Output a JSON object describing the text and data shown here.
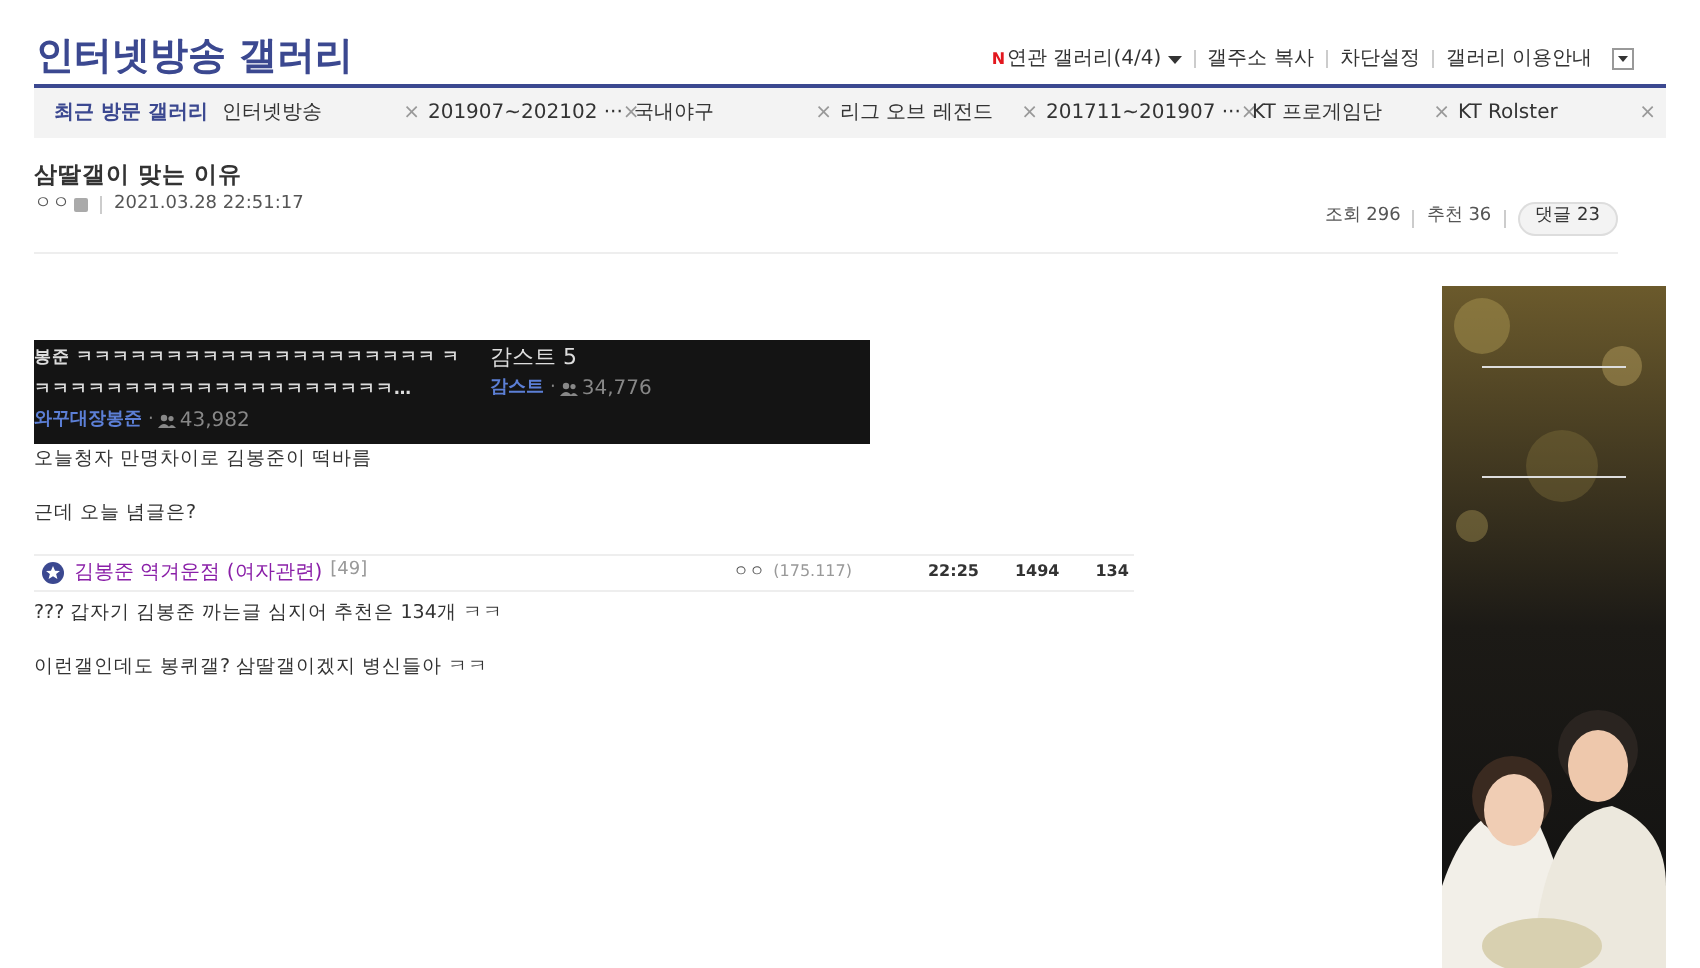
{
  "gallery": {
    "title": "인터넷방송 갤러리"
  },
  "top_links": [
    {
      "kind": "dropdown",
      "new_mark": "N",
      "label": "연관 갤러리(4/4)"
    },
    {
      "kind": "link",
      "label": "갤주소 복사"
    },
    {
      "kind": "link",
      "label": "차단설정"
    },
    {
      "kind": "link",
      "label": "갤러리 이용안내"
    },
    {
      "kind": "menu"
    }
  ],
  "recent_bar": {
    "label": "최근 방문 갤러리",
    "remove_mark": "×",
    "items": [
      "인터넷방송",
      "201907~202102 ···",
      "국내야구",
      "리그 오브 레전드",
      "201711~201907 ···",
      "KT 프로게임단",
      "KT Rolster"
    ]
  },
  "post": {
    "title": "삼딸갤이 맞는 이유",
    "author": "ㅇㅇ",
    "date": "2021.03.28 22:51:17",
    "views_label": "조회",
    "views": "296",
    "recommend_label": "추천",
    "recommend": "36",
    "comments_button": "댓글 23"
  },
  "body": [
    {
      "kind": "streams",
      "separator": "·",
      "streams": [
        {
          "title": "봉준 ㅋㅋㅋㅋㅋㅋㅋㅋㅋㅋㅋㅋㅋㅋㅋㅋㅋㅋㅋㅋ ㅋㅋㅋㅋㅋㅋㅋㅋㅋㅋㅋㅋㅋㅋㅋㅋㅋㅋㅋㅋㅋ…",
          "channel": "와꾸대장봉준",
          "viewers": "43,982"
        },
        {
          "title": "감스트 5",
          "channel": "감스트",
          "viewers": "34,776"
        }
      ]
    },
    {
      "kind": "text",
      "text": "오늘청자 만명차이로 김봉준이 떡바름"
    },
    {
      "kind": "text",
      "text": "근데 오늘 념글은?"
    },
    {
      "kind": "post_row",
      "title": "김봉준 역겨운점 (여자관련)",
      "comments": "[49]",
      "writer": "ㅇㅇ",
      "ip": "(175.117)",
      "time": "22:25",
      "views": "1494",
      "recommend": "134"
    },
    {
      "kind": "text",
      "text": "??? 갑자기 김봉준 까는글 심지어 추천은 134개 ㅋㅋ"
    },
    {
      "kind": "text",
      "text": "이런갤인데도 봉퀴갤? 삼딸갤이겠지 병신들아 ㅋㅋ"
    }
  ]
}
